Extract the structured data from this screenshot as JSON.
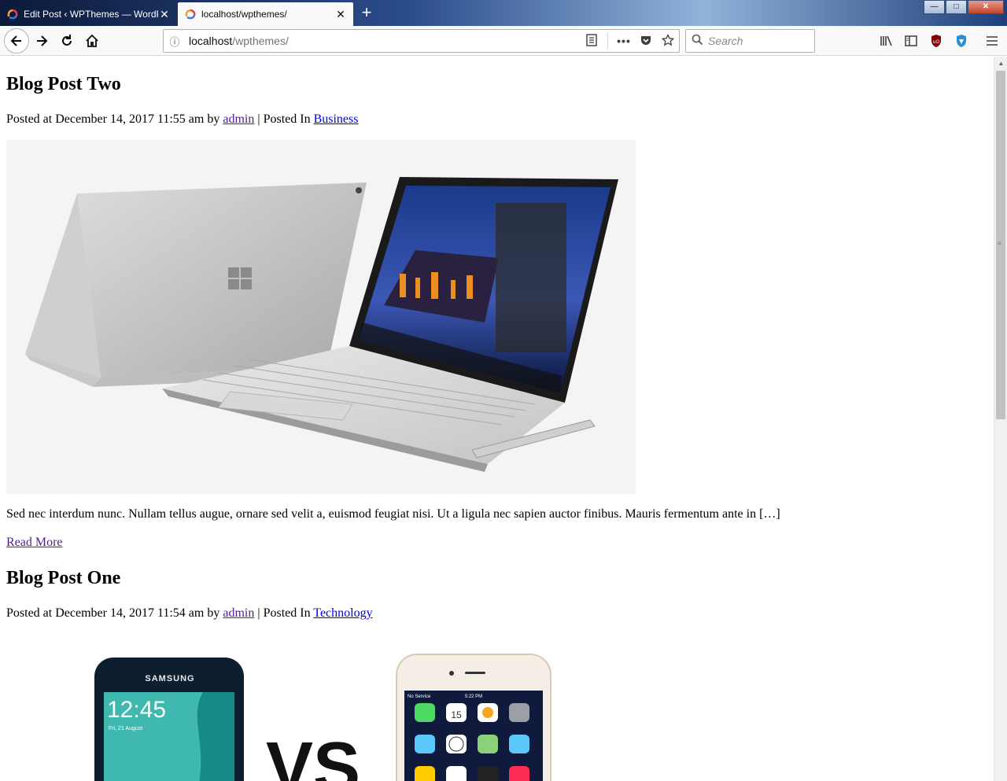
{
  "browser": {
    "tabs": [
      {
        "title": "Edit Post ‹ WPThemes — WordPress",
        "active": false
      },
      {
        "title": "localhost/wpthemes/",
        "active": true
      }
    ],
    "new_tab_label": "+",
    "window_controls": {
      "minimize": "—",
      "restore": "□",
      "close": "✕"
    },
    "url": {
      "host": "localhost",
      "path": "/wpthemes/"
    },
    "search_placeholder": "Search",
    "icons": [
      "back-icon",
      "forward-icon",
      "reload-icon",
      "home-icon",
      "info-icon",
      "reader-view-icon",
      "page-actions-icon",
      "pocket-icon",
      "bookmark-star-icon",
      "search-icon",
      "library-icon",
      "sidebar-icon",
      "ublock-icon",
      "shield-icon",
      "menu-icon"
    ]
  },
  "posts": [
    {
      "title": "Blog Post Two",
      "meta_prefix": "Posted at December 14, 2017 11:55 am by ",
      "author": "admin",
      "meta_sep": " | Posted In ",
      "category": "Business",
      "excerpt": "Sed nec interdum nunc. Nullam tellus augue, ornare sed velit a, euismod feugiat nisi. Ut a ligula nec sapien auctor finibus. Mauris fermentum ante in […]",
      "read_more": "Read More",
      "image": "laptop-image"
    },
    {
      "title": "Blog Post One",
      "meta_prefix": "Posted at December 14, 2017 11:54 am by ",
      "author": "admin",
      "meta_sep": " | Posted In ",
      "category": "Technology",
      "image": "phones-image",
      "image_text": {
        "samsung": "SAMSUNG",
        "clock": "12:45",
        "date": "Fri, 21 August",
        "carrier": "No Service",
        "time": "5:22 PM",
        "cal_day": "15",
        "vs": "VS"
      }
    }
  ]
}
